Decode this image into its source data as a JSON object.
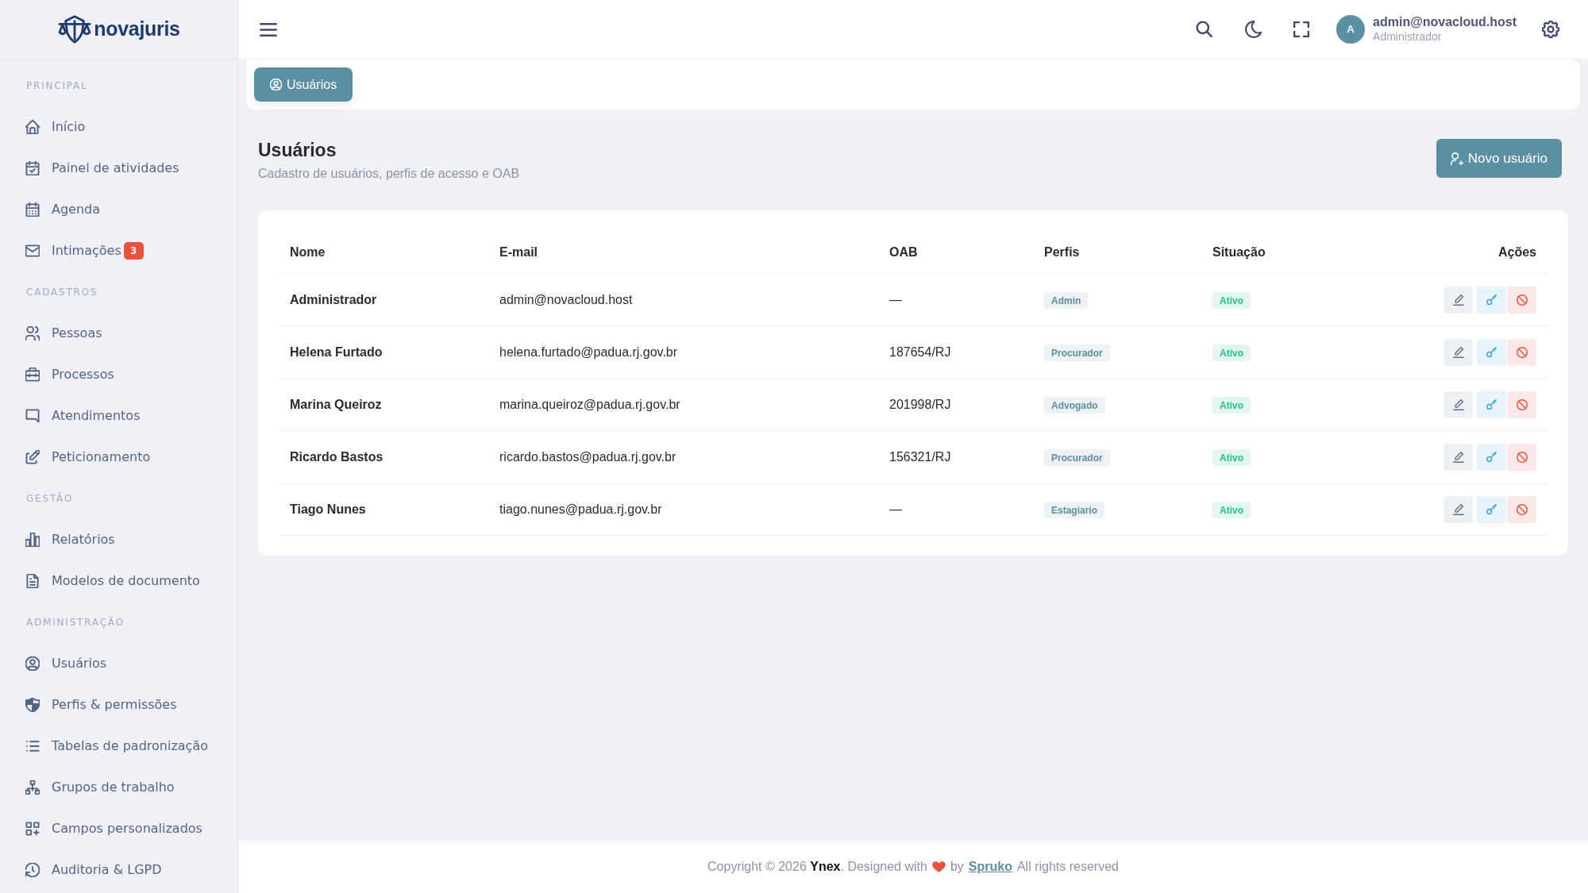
{
  "brand": {
    "name": "novajuris"
  },
  "sidebar": {
    "sections": [
      {
        "title": "PRINCIPAL",
        "items": [
          {
            "label": "Início"
          },
          {
            "label": "Painel de atividades"
          },
          {
            "label": "Agenda"
          },
          {
            "label": "Intimações",
            "badge": "3"
          }
        ]
      },
      {
        "title": "CADASTROS",
        "items": [
          {
            "label": "Pessoas"
          },
          {
            "label": "Processos"
          },
          {
            "label": "Atendimentos"
          },
          {
            "label": "Peticionamento"
          }
        ]
      },
      {
        "title": "GESTÃO",
        "items": [
          {
            "label": "Relatórios"
          },
          {
            "label": "Modelos de documento"
          }
        ]
      },
      {
        "title": "ADMINISTRAÇÃO",
        "items": [
          {
            "label": "Usuários"
          },
          {
            "label": "Perfis & permissões"
          },
          {
            "label": "Tabelas de padronização"
          },
          {
            "label": "Grupos de trabalho"
          },
          {
            "label": "Campos personalizados"
          },
          {
            "label": "Auditoria & LGPD"
          }
        ]
      }
    ]
  },
  "header": {
    "user": {
      "initial": "A",
      "email": "admin@novacloud.host",
      "role": "Administrador"
    }
  },
  "tabs": [
    {
      "label": "Usuários",
      "selected": true
    }
  ],
  "page": {
    "title": "Usuários",
    "subtitle": "Cadastro de usuários, perfis de acesso e OAB",
    "new_button": "Novo usuário"
  },
  "table": {
    "columns": [
      "Nome",
      "E-mail",
      "OAB",
      "Perfis",
      "Situação",
      "Ações"
    ],
    "rows": [
      {
        "name": "Administrador",
        "email": "admin@novacloud.host",
        "oab": "—",
        "profile": "Admin",
        "status": "Ativo"
      },
      {
        "name": "Helena Furtado",
        "email": "helena.furtado@padua.rj.gov.br",
        "oab": "187654/RJ",
        "profile": "Procurador",
        "status": "Ativo"
      },
      {
        "name": "Marina Queiroz",
        "email": "marina.queiroz@padua.rj.gov.br",
        "oab": "201998/RJ",
        "profile": "Advogado",
        "status": "Ativo"
      },
      {
        "name": "Ricardo Bastos",
        "email": "ricardo.bastos@padua.rj.gov.br",
        "oab": "156321/RJ",
        "profile": "Procurador",
        "status": "Ativo"
      },
      {
        "name": "Tiago Nunes",
        "email": "tiago.nunes@padua.rj.gov.br",
        "oab": "—",
        "profile": "Estagiario",
        "status": "Ativo"
      }
    ]
  },
  "footer": {
    "copyright": "Copyright © 2026 **Ynex**. Designed with",
    "by": "by",
    "link": "Spruko",
    "rights": "All rights reserved"
  }
}
